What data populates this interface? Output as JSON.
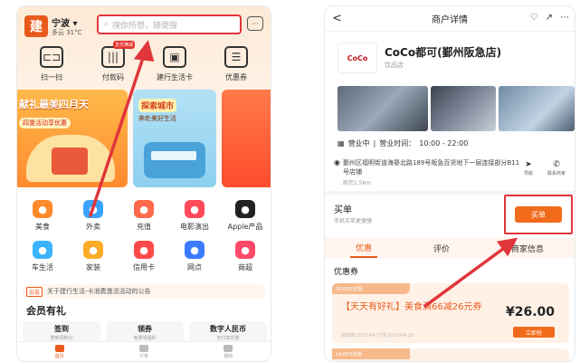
{
  "left": {
    "city": "宁波",
    "weather": "多云 31°C",
    "search_placeholder": "搜你所想，随便搜",
    "quick": [
      {
        "label": "扫一扫",
        "icon": "scan-icon"
      },
      {
        "label": "付款码",
        "icon": "pay-code-icon",
        "badge": "支付满减"
      },
      {
        "label": "建行生活卡",
        "icon": "life-card-icon"
      },
      {
        "label": "优惠券",
        "icon": "coupon-icon"
      }
    ],
    "banner1": {
      "title": "献礼最美四月天",
      "subtitle": "四重活动享优惠"
    },
    "banner2": {
      "title": "探索城市",
      "subtitle": "奔赴美好生活"
    },
    "grid": [
      [
        {
          "label": "美食",
          "icon": "food-icon",
          "color": "#ff8a2a"
        },
        {
          "label": "外卖",
          "icon": "delivery-icon",
          "color": "#3aa3ff"
        },
        {
          "label": "充值",
          "icon": "recharge-icon",
          "color": "#ff6a4a"
        },
        {
          "label": "电影演出",
          "icon": "movie-icon",
          "color": "#ff4a5a"
        },
        {
          "label": "Apple产品",
          "icon": "apple-icon",
          "color": "#222222"
        }
      ],
      [
        {
          "label": "车生活",
          "icon": "car-icon",
          "color": "#3bb3ff"
        },
        {
          "label": "家装",
          "icon": "home-icon",
          "color": "#ffab2a"
        },
        {
          "label": "信用卡",
          "icon": "credit-card-icon",
          "color": "#ff4a4a"
        },
        {
          "label": "网点",
          "icon": "branch-icon",
          "color": "#3a7bff"
        },
        {
          "label": "商超",
          "icon": "cart-icon",
          "color": "#ff4a6a"
        }
      ]
    ],
    "notice_tag": "公告",
    "notice_text": "关于建行生活-卡消费激活活动的公告",
    "member_title": "会员有礼",
    "member_cards": [
      {
        "title": "签到",
        "sub": "签到领积分"
      },
      {
        "title": "领券",
        "sub": "免费领福利"
      },
      {
        "title": "数字人民币",
        "sub": "支付享优惠"
      }
    ],
    "tabs": [
      {
        "label": "首页",
        "active": true
      },
      {
        "label": "订单",
        "active": false
      },
      {
        "label": "我的",
        "active": false
      }
    ]
  },
  "right": {
    "back": "<",
    "title": "商户详情",
    "brand_logo": "CoCo",
    "name": "CoCo都可(鄞州阪急店)",
    "category": "饮品店",
    "hours_status": "营业中",
    "hours_label": "营业时间：",
    "hours": "10:00 - 22:00",
    "address": "鄞州区福明街道海晏北路189号阪急百货地下一层连接部分B11号店铺",
    "distance": "距您1.5km",
    "actions": [
      {
        "label": "导航",
        "icon": "navigate-icon"
      },
      {
        "label": "联系商家",
        "icon": "phone-icon"
      }
    ],
    "buy_title": "买单",
    "buy_sub": "手机买单更便捷",
    "buy_button": "买单",
    "tabs": [
      {
        "label": "优惠",
        "active": true
      },
      {
        "label": "评价",
        "active": false
      },
      {
        "label": "商家信息",
        "active": false
      }
    ],
    "coupon_section": "优惠券",
    "coupon": {
      "strip": "26.00元优惠",
      "name": "【天天有好礼】美食满66减26元券",
      "date": "有效期:2023-04-17至2023-04-18",
      "price": "¥26.00",
      "button": "立即抢"
    },
    "coupon2_strip": "14.00元优惠"
  },
  "colors": {
    "accent": "#e85a1c",
    "highlight": "#e0353a",
    "button": "#f26a1b"
  }
}
